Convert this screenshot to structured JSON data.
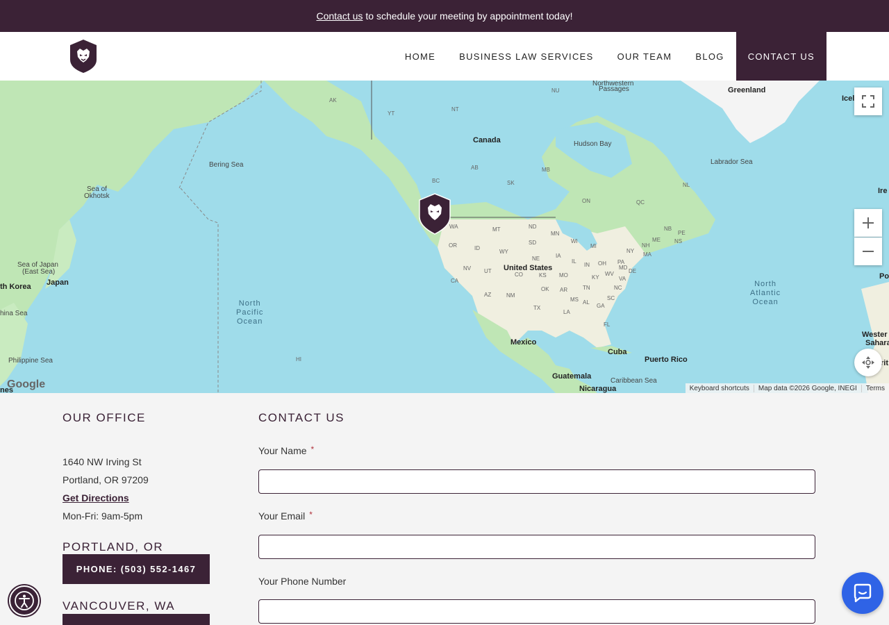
{
  "announcement": {
    "link": "Contact us",
    "text": "to schedule your meeting by appointment today!"
  },
  "nav": {
    "items": [
      {
        "label": "HOME"
      },
      {
        "label": "BUSINESS LAW SERVICES"
      },
      {
        "label": "OUR TEAM"
      },
      {
        "label": "BLOG"
      },
      {
        "label": "CONTACT US"
      }
    ],
    "active_index": 4
  },
  "map": {
    "labels": {
      "greenland": "Greenland",
      "canada": "Canada",
      "united_states": "United States",
      "mexico": "Mexico",
      "cuba": "Cuba",
      "puerto_rico": "Puerto Rico",
      "guatemala": "Guatemala",
      "nicaragua": "Nicaragua",
      "japan": "Japan",
      "north_korea": "th Korea",
      "china_sea": "hina Sea",
      "philippine_sea": "Philippine Sea",
      "sea_of_japan": "Sea of Japan",
      "east_sea": "(East Sea)",
      "sea_of_okhotsk": "Sea of",
      "okhotsk": "Okhotsk",
      "bering_sea": "Bering Sea",
      "hudson_bay": "Hudson Bay",
      "labrador_sea": "Labrador Sea",
      "caribbean_sea": "Caribbean Sea",
      "northwestern": "Northwestern",
      "passages": "Passages",
      "north_pacific": "North",
      "pacific": "Pacific",
      "ocean_p": "Ocean",
      "north_atlantic": "North",
      "atlantic": "Atlantic",
      "ocean_a": "Ocean",
      "western": "Wester",
      "sahara": "Sahara",
      "ice": "Icel",
      "ire": "Ire",
      "po": "Po",
      "rit": "rit",
      "nes": "nes",
      "hi": "HI",
      "ak": "AK",
      "yt": "YT",
      "nt": "NT",
      "nu": "NU",
      "bc": "BC",
      "ab": "AB",
      "sk": "SK",
      "mb": "MB",
      "on": "ON",
      "qc": "QC",
      "nl": "NL",
      "nb": "NB",
      "pe": "PE",
      "ns": "NS",
      "wa": "WA",
      "or": "OR",
      "id": "ID",
      "mt": "MT",
      "nd": "ND",
      "mn": "MN",
      "sd": "SD",
      "wy": "WY",
      "nv": "NV",
      "ut": "UT",
      "ca": "CA",
      "az": "AZ",
      "nm": "NM",
      "co": "CO",
      "ne": "NE",
      "ks": "KS",
      "ia": "IA",
      "wi": "WI",
      "mi": "MI",
      "il": "IL",
      "in": "IN",
      "oh": "OH",
      "mo": "MO",
      "ok": "OK",
      "ar": "AR",
      "tx": "TX",
      "la": "LA",
      "ms": "MS",
      "al": "AL",
      "tn": "TN",
      "ky": "KY",
      "ga": "GA",
      "fl": "FL",
      "sc": "SC",
      "nc": "NC",
      "va": "VA",
      "wv": "WV",
      "pa": "PA",
      "ny": "NY",
      "md": "MD",
      "de": "DE",
      "nh": "NH",
      "ma": "MA",
      "me": "ME"
    },
    "footer": {
      "shortcuts": "Keyboard shortcuts",
      "data": "Map data ©2026 Google, INEGI",
      "terms": "Terms"
    },
    "google": "Google"
  },
  "office": {
    "title": "OUR OFFICE",
    "street": "1640 NW Irving St",
    "city": "Portland, OR 97209",
    "directions": "Get Directions",
    "hours": "Mon-Fri: 9am-5pm",
    "locations": [
      {
        "city": "PORTLAND, OR",
        "phone": "PHONE: (503) 552-1467"
      },
      {
        "city": "VANCOUVER, WA",
        "phone": ""
      }
    ]
  },
  "form": {
    "title": "CONTACT US",
    "fields": [
      {
        "label": "Your Name",
        "required": "*",
        "value": ""
      },
      {
        "label": "Your Email",
        "required": "*",
        "value": ""
      },
      {
        "label": "Your Phone Number",
        "required": "",
        "value": ""
      }
    ]
  },
  "colors": {
    "brand": "#3b2236",
    "chat": "#2f63e6",
    "water": "#9fdcea",
    "land": "#bfe6b5"
  }
}
